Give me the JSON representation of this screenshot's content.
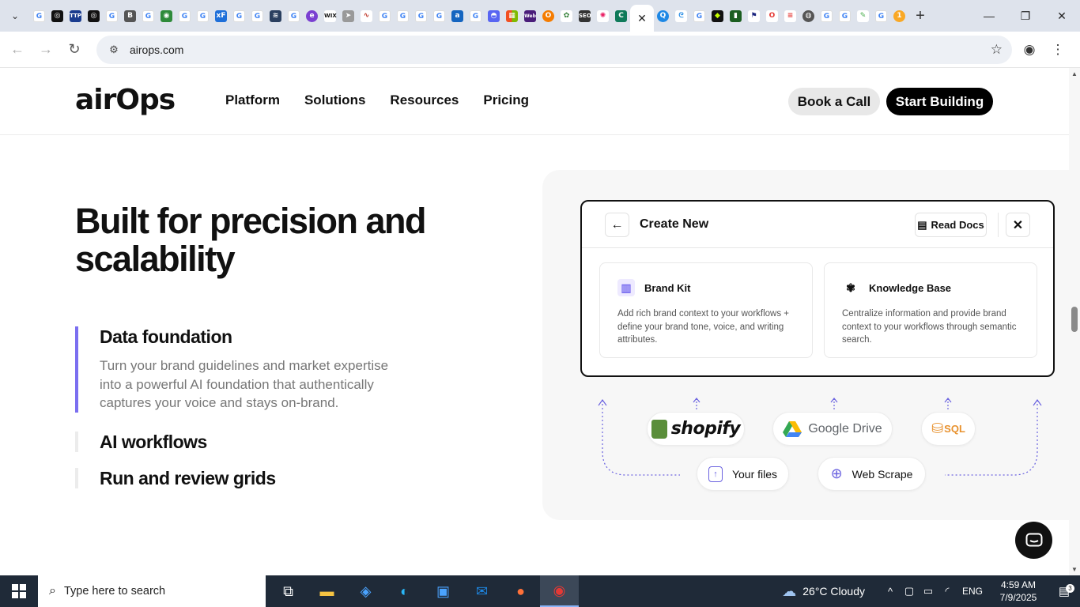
{
  "browser": {
    "url": "airops.com",
    "tab_close": "✕",
    "new_tab": "+"
  },
  "site": {
    "logo": "airOps",
    "nav": [
      "Platform",
      "Solutions",
      "Resources",
      "Pricing"
    ],
    "book_call": "Book a Call",
    "start_building": "Start Building"
  },
  "hero": {
    "headline": "Built for precision and scalability",
    "features": [
      {
        "title": "Data foundation",
        "description": "Turn your brand guidelines and market expertise into a powerful AI foundation that authentically captures your voice and stays on-brand."
      },
      {
        "title": "AI workflows"
      },
      {
        "title": "Run and review grids"
      }
    ]
  },
  "modal": {
    "title": "Create New",
    "read_docs": "Read Docs",
    "cards": [
      {
        "title": "Brand Kit",
        "description": "Add rich brand context to your workflows + define your brand tone, voice, and writing attributes."
      },
      {
        "title": "Knowledge Base",
        "description": "Centralize information and provide brand context to your workflows through semantic search."
      }
    ]
  },
  "integrations": {
    "shopify": "shopify",
    "google_drive": "Google Drive",
    "sql": "SQL",
    "your_files": "Your files",
    "web_scrape": "Web Scrape"
  },
  "taskbar": {
    "search_placeholder": "Type here to search",
    "weather": "26°C  Cloudy",
    "language": "ENG",
    "time": "4:59 AM",
    "date": "7/9/2025",
    "notifications": "3"
  }
}
